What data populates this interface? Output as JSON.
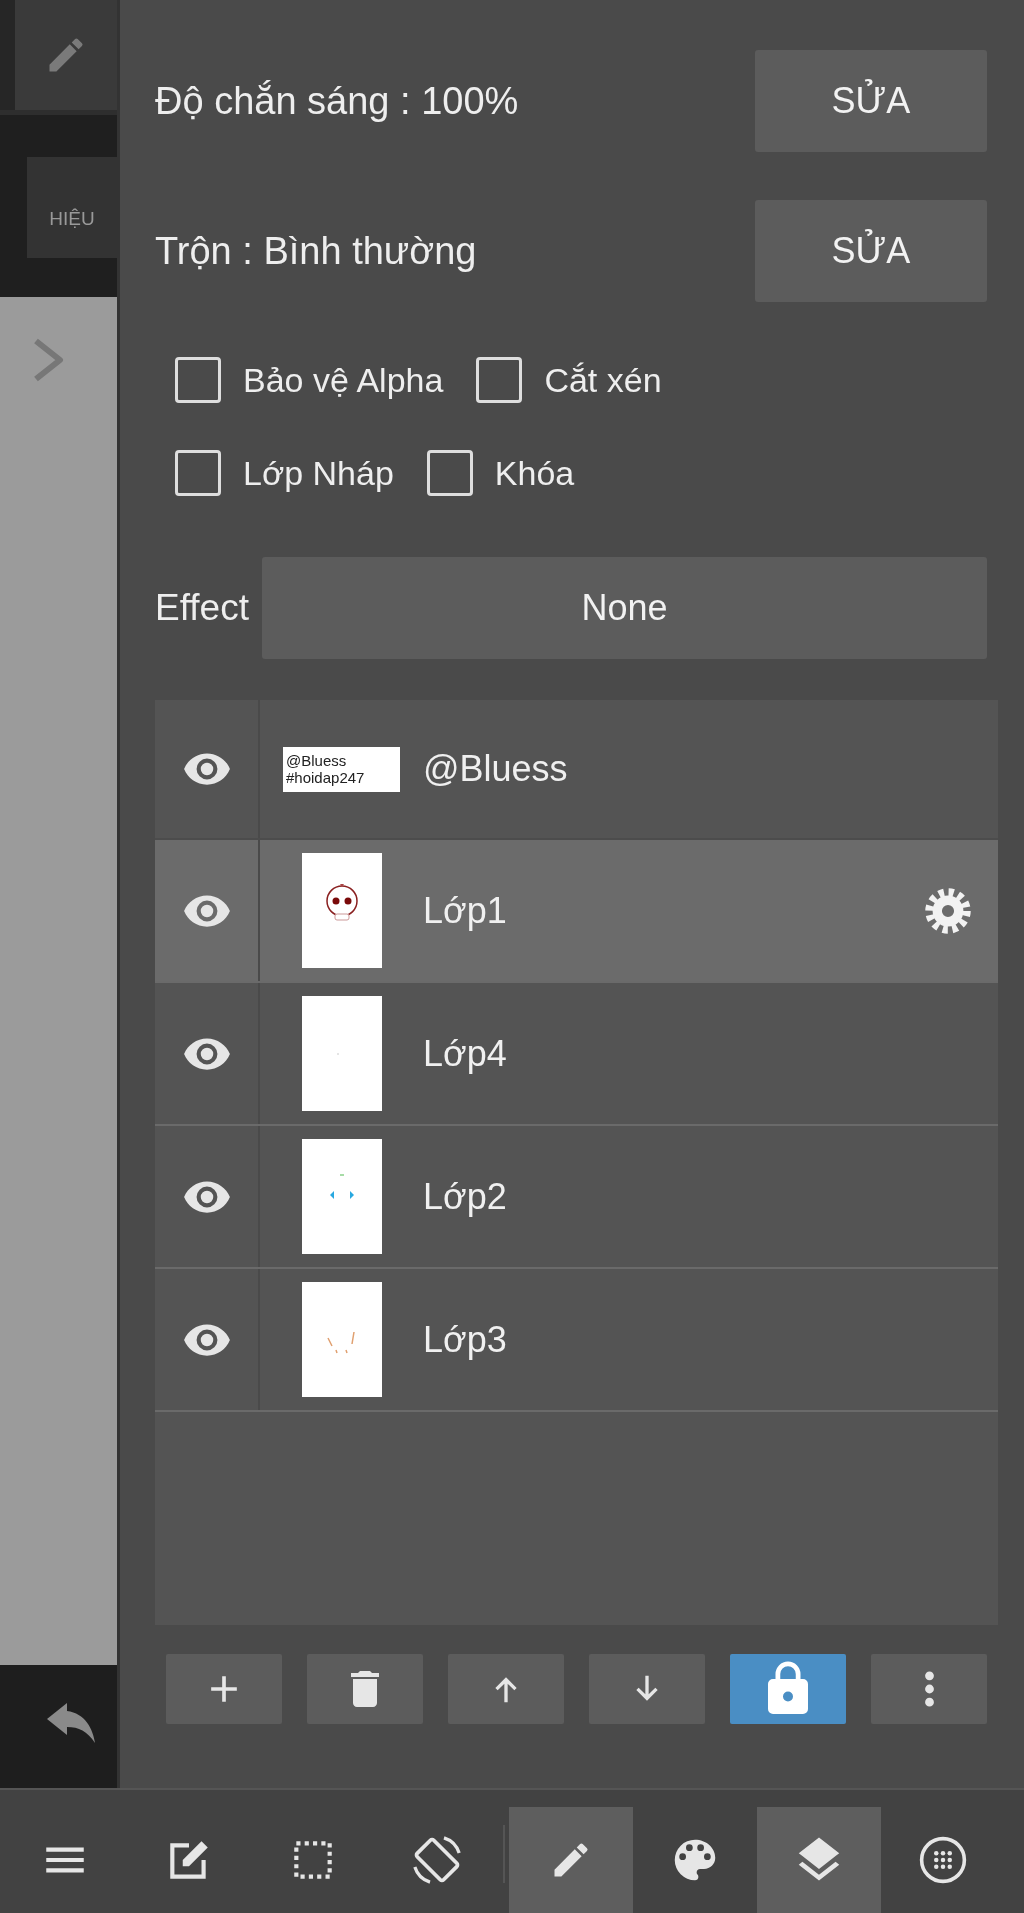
{
  "left_strip": {
    "effect_button": "HIỆU"
  },
  "opacity": {
    "label": "Độ chắn sáng : 100%",
    "button": "SỬA"
  },
  "blend": {
    "label": "Trộn : Bình thường",
    "button": "SỬA"
  },
  "option_rows": [
    [
      {
        "label": "Bảo vệ Alpha",
        "checked": false
      },
      {
        "label": "Cắt xén",
        "checked": false
      }
    ],
    [
      {
        "label": "Lớp Nháp",
        "checked": false
      },
      {
        "label": "Khóa",
        "checked": false
      }
    ]
  ],
  "effect": {
    "label": "Effect",
    "value": "None"
  },
  "layers": [
    {
      "kind": "folder",
      "name": "@Bluess",
      "visible": true,
      "selected": false,
      "thumbnail_text": [
        "@Bluess",
        "#hoidap247"
      ]
    },
    {
      "kind": "layer",
      "name": "Lớp1",
      "visible": true,
      "selected": true
    },
    {
      "kind": "layer",
      "name": "Lớp4",
      "visible": true,
      "selected": false
    },
    {
      "kind": "layer",
      "name": "Lớp2",
      "visible": true,
      "selected": false
    },
    {
      "kind": "layer",
      "name": "Lớp3",
      "visible": true,
      "selected": false
    }
  ],
  "layer_buttons": [
    {
      "kind": "add",
      "on": false
    },
    {
      "kind": "delete",
      "on": false
    },
    {
      "kind": "up",
      "on": false
    },
    {
      "kind": "down",
      "on": false
    },
    {
      "kind": "lock",
      "on": true
    },
    {
      "kind": "more",
      "on": false
    }
  ],
  "toolbar": [
    {
      "kind": "menu",
      "selected": false
    },
    {
      "kind": "edit",
      "selected": false
    },
    {
      "kind": "select",
      "selected": false
    },
    {
      "kind": "rotate",
      "selected": false
    },
    {
      "kind": "divider"
    },
    {
      "kind": "pencil",
      "selected": true
    },
    {
      "kind": "palette",
      "selected": false
    },
    {
      "kind": "layers",
      "selected": true
    },
    {
      "kind": "grid",
      "selected": false
    }
  ]
}
